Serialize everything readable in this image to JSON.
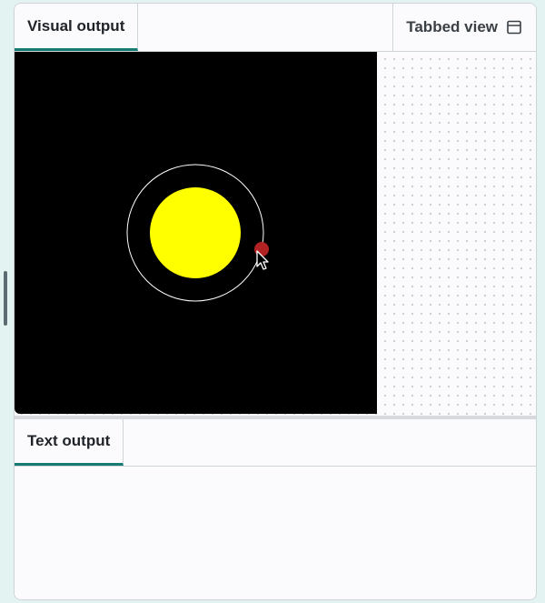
{
  "visual_panel": {
    "tab_label": "Visual output",
    "tabbed_view_label": "Tabbed view",
    "tabbed_view_icon": "browser-window-icon"
  },
  "text_panel": {
    "tab_label": "Text output",
    "content": ""
  },
  "scene": {
    "background_color": "#000000",
    "sun_color": "#ffff00",
    "orbit_color": "#ffffff",
    "planet_color": "#b22222",
    "pointer_icon": "mouse-pointer-icon"
  },
  "theme": {
    "accent": "#147c72",
    "page_background": "#e3f3f2"
  }
}
